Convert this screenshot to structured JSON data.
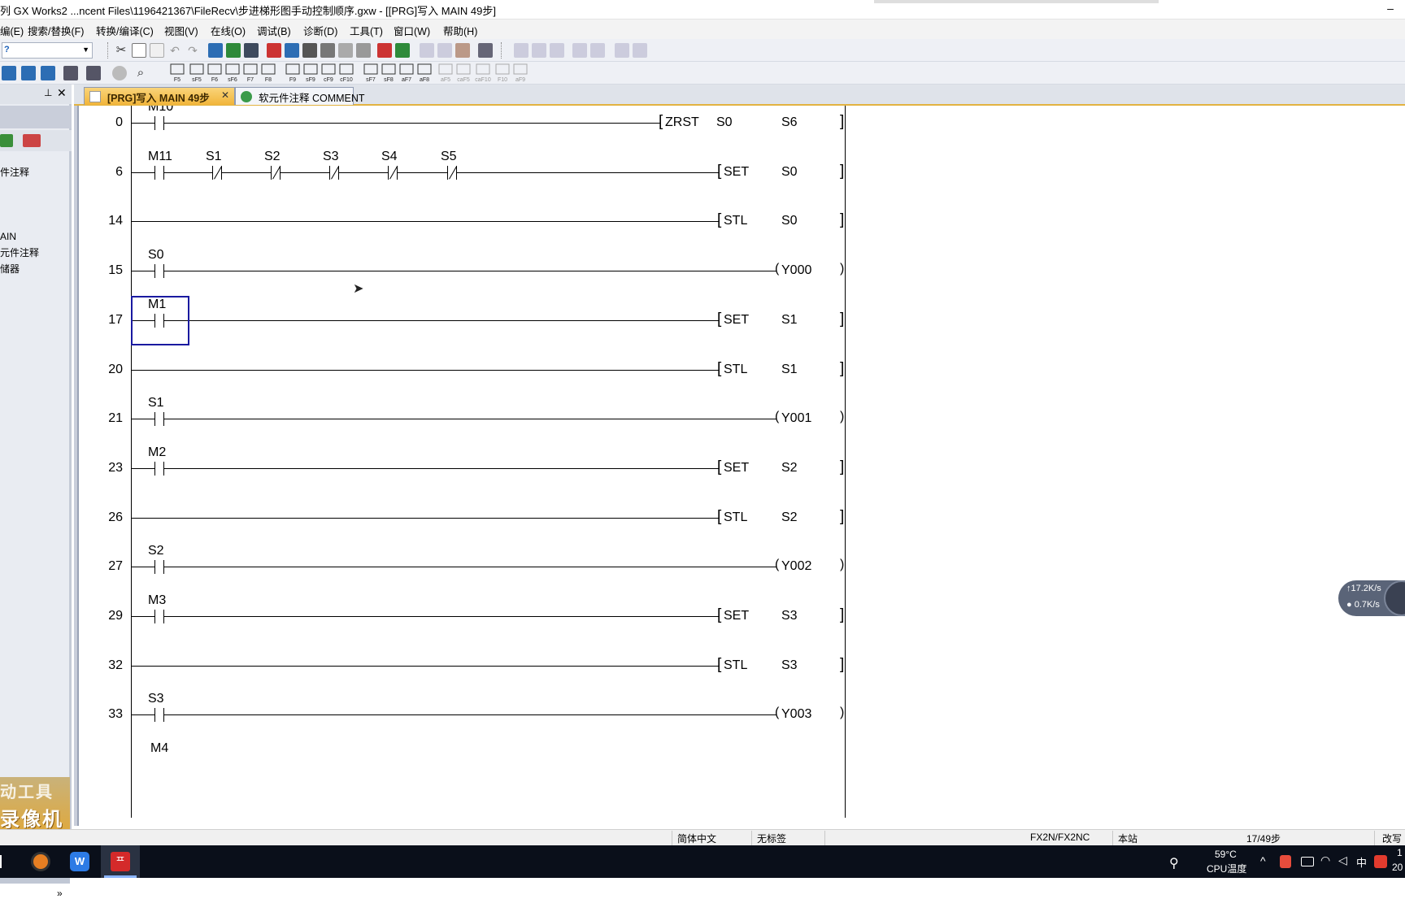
{
  "window": {
    "title": "列 GX Works2 ...ncent Files\\1196421367\\FileRecv\\步进梯形图手动控制顺序.gxw - [[PRG]写入 MAIN 49步]",
    "minimize_glyph": "–"
  },
  "menu": {
    "items": [
      "编(E)",
      "搜索/替换(F)",
      "转换/编译(C)",
      "视图(V)",
      "在线(O)",
      "调试(B)",
      "诊断(D)",
      "工具(T)",
      "窗口(W)",
      "帮助(H)"
    ]
  },
  "toolbar2_labels": [
    "F5",
    "sF5",
    "F6",
    "sF6",
    "F7",
    "F8",
    "F9",
    "sF9",
    "cF9",
    "cF10",
    "sF7",
    "sF8",
    "aF7",
    "aF8",
    "aF5",
    "caF5",
    "caF10",
    "F10",
    "aF9"
  ],
  "navigator": {
    "pin_glyph": "⊥",
    "close_glyph": "✕",
    "tree_items": [
      "件注释",
      "AIN",
      "元件注释",
      "储器"
    ],
    "badge_line1": "动工具",
    "badge_line2": "录像机",
    "chevron": "»"
  },
  "tabs": [
    {
      "label": "[PRG]写入 MAIN 49步",
      "active": true,
      "close": "✕"
    },
    {
      "label": "软元件注释 COMMENT",
      "active": false
    }
  ],
  "ladder": {
    "rungs": [
      {
        "step": "0",
        "contacts": [
          {
            "label": "M10",
            "type": "NO"
          }
        ],
        "instruction": {
          "kind": "bracket",
          "op": "ZRST",
          "args": [
            "S0",
            "S6"
          ]
        }
      },
      {
        "step": "6",
        "contacts": [
          {
            "label": "M11",
            "type": "NO"
          },
          {
            "label": "S1",
            "type": "NC"
          },
          {
            "label": "S2",
            "type": "NC"
          },
          {
            "label": "S3",
            "type": "NC"
          },
          {
            "label": "S4",
            "type": "NC"
          },
          {
            "label": "S5",
            "type": "NC"
          }
        ],
        "instruction": {
          "kind": "bracket",
          "op": "SET",
          "args": [
            "S0"
          ]
        }
      },
      {
        "step": "14",
        "contacts": [],
        "instruction": {
          "kind": "bracket",
          "op": "STL",
          "args": [
            "S0"
          ]
        }
      },
      {
        "step": "15",
        "contacts": [
          {
            "label": "S0",
            "type": "NO"
          }
        ],
        "instruction": {
          "kind": "coil",
          "op": "Y000",
          "args": []
        }
      },
      {
        "step": "17",
        "contacts": [
          {
            "label": "M1",
            "type": "NO"
          }
        ],
        "instruction": {
          "kind": "bracket",
          "op": "SET",
          "args": [
            "S1"
          ]
        }
      },
      {
        "step": "20",
        "contacts": [],
        "instruction": {
          "kind": "bracket",
          "op": "STL",
          "args": [
            "S1"
          ]
        }
      },
      {
        "step": "21",
        "contacts": [
          {
            "label": "S1",
            "type": "NO"
          }
        ],
        "instruction": {
          "kind": "coil",
          "op": "Y001",
          "args": []
        }
      },
      {
        "step": "23",
        "contacts": [
          {
            "label": "M2",
            "type": "NO"
          }
        ],
        "instruction": {
          "kind": "bracket",
          "op": "SET",
          "args": [
            "S2"
          ]
        }
      },
      {
        "step": "26",
        "contacts": [],
        "instruction": {
          "kind": "bracket",
          "op": "STL",
          "args": [
            "S2"
          ]
        }
      },
      {
        "step": "27",
        "contacts": [
          {
            "label": "S2",
            "type": "NO"
          }
        ],
        "instruction": {
          "kind": "coil",
          "op": "Y002",
          "args": []
        }
      },
      {
        "step": "29",
        "contacts": [
          {
            "label": "M3",
            "type": "NO"
          }
        ],
        "instruction": {
          "kind": "bracket",
          "op": "SET",
          "args": [
            "S3"
          ]
        }
      },
      {
        "step": "32",
        "contacts": [],
        "instruction": {
          "kind": "bracket",
          "op": "STL",
          "args": [
            "S3"
          ]
        }
      },
      {
        "step": "33",
        "contacts": [
          {
            "label": "S3",
            "type": "NO"
          }
        ],
        "instruction": {
          "kind": "coil",
          "op": "Y003",
          "args": []
        }
      }
    ],
    "partial_next_label": "M4",
    "cursor_rung": 4
  },
  "status": {
    "language": "简体中文",
    "label_state": "无标签",
    "plc_type": "FX2N/FX2NC",
    "station": "本站",
    "step_info": "17/49步",
    "mode": "改写"
  },
  "netwidget": {
    "up": "↑17.2K/s",
    "down": "● 0.7K/s"
  },
  "taskbar": {
    "temperature": "59°C",
    "temp_label": "CPU温度",
    "ime": "中",
    "clock_partial": "20",
    "clock_top_partial": "1"
  },
  "colors": {
    "tab_active": "#f1b53a",
    "cursor": "#1a1aa0",
    "taskbar": "#0a0f1a"
  }
}
